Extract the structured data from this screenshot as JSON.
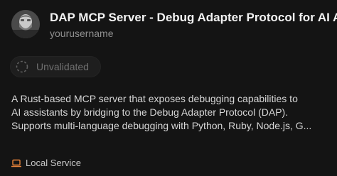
{
  "card": {
    "title": "DAP MCP Server - Debug Adapter Protocol for AI Ag",
    "owner": "yourusername",
    "avatar_icon": "user-avatar",
    "status_badge": {
      "label": "Unvalidated",
      "icon": "dashed-circle-icon"
    },
    "description_lines": [
      "A Rust-based MCP server that exposes debugging capabilities to",
      "AI assistants by bridging to the Debug Adapter Protocol (DAP).",
      "Supports multi-language debugging with Python, Ruby, Node.js, G..."
    ],
    "footer": {
      "label": "Local Service",
      "icon": "laptop-icon"
    }
  },
  "colors": {
    "background": "#141414",
    "title": "#f2f2f2",
    "owner": "#8f8f8f",
    "badge_text": "#6f6f6f",
    "description": "#d6d6d6",
    "footer_icon": "#e8833a"
  }
}
